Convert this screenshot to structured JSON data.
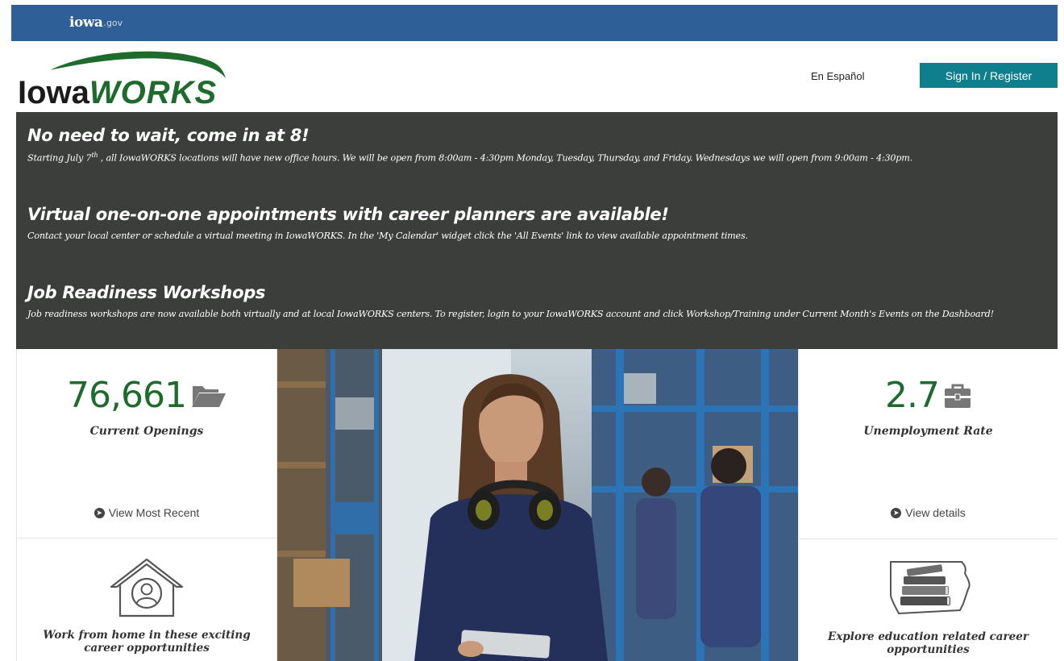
{
  "gov_bar": {
    "logo_word": "iowa",
    "logo_suffix": ".gov"
  },
  "header": {
    "brand_prefix": "Iowa",
    "brand_suffix": "WORKS",
    "language_link": "En Español",
    "sign_in_label": "Sign In / Register"
  },
  "announcements": [
    {
      "title": "No need to wait, come in at 8!",
      "body_start": "Starting July 7",
      "body_sup": "th",
      "body_end": " , all IowaWORKS locations will have new office hours. We will be open from 8:00am - 4:30pm Monday, Tuesday, Thursday, and Friday. Wednesdays we will open from 9:00am - 4:30pm."
    },
    {
      "title": "Virtual one-on-one appointments with career planners are available!",
      "body": "Contact your local center or schedule a virtual meeting in IowaWORKS. In the 'My Calendar' widget click the 'All Events' link to view available appointment times."
    },
    {
      "title": "Job Readiness Workshops",
      "body": "Job readiness workshops are now available both virtually and at local IowaWORKS centers. To register, login to your IowaWORKS account and click Workshop/Training under Current Month's Events on the Dashboard!"
    }
  ],
  "stats": {
    "openings": {
      "value": "76,661",
      "label": "Current Openings",
      "link": "View Most Recent",
      "icon": "folder-open-icon"
    },
    "unemployment": {
      "value": "2.7",
      "label": "Unemployment Rate",
      "link": "View details",
      "icon": "briefcase-icon"
    }
  },
  "cards": {
    "work_from_home": {
      "label": "Work from home in these exciting career opportunities",
      "icon": "house-person-icon"
    },
    "education": {
      "label": "Explore education related career opportunities",
      "icon": "books-iowa-icon"
    }
  },
  "colors": {
    "gov_bar": "#2e5f97",
    "brand_green": "#1e6b2d",
    "button_teal": "#0f7f8d",
    "announcement_bg": "#3b3e3b"
  }
}
